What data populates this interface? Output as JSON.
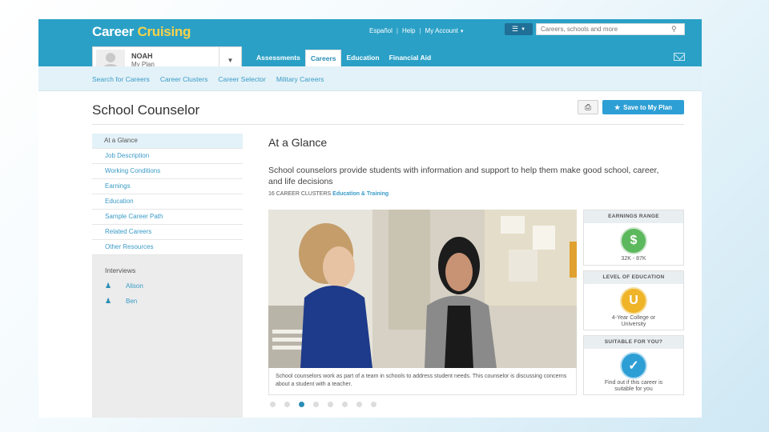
{
  "header": {
    "logo_part1": "Career ",
    "logo_part2": "Cruising",
    "links": [
      "Español",
      "Help",
      "My Account"
    ],
    "search_placeholder": "Careers, schools and more",
    "user": {
      "name": "NOAH",
      "plan": "My Plan"
    },
    "nav": [
      "Assessments",
      "Careers",
      "Education",
      "Financial Aid"
    ],
    "active_nav": "Careers"
  },
  "subnav": [
    "Search for Careers",
    "Career Clusters",
    "Career Selector",
    "Military Careers"
  ],
  "page": {
    "title": "School Counselor",
    "print_icon": "printer-icon",
    "save_label": "Save to My Plan"
  },
  "sidebar": {
    "items": [
      "At a Glance",
      "Job Description",
      "Working Conditions",
      "Earnings",
      "Education",
      "Sample Career Path",
      "Related Careers",
      "Other Resources"
    ],
    "active": "At a Glance",
    "interviews_label": "Interviews",
    "interviews": [
      "Alison",
      "Ben"
    ]
  },
  "content": {
    "heading": "At a Glance",
    "description": "School counselors provide students with information and support to help them make good school, career, and life decisions",
    "clusters_label": "16 CAREER CLUSTERS",
    "clusters_value": "Education & Training",
    "caption": "School counselors work as part of a team in schools to address student needs. This counselor is discussing concerns about a student with a teacher.",
    "slides_total": 8,
    "slide_active": 3
  },
  "cards": {
    "earnings": {
      "title": "EARNINGS RANGE",
      "symbol": "$",
      "value": "32K - 87K"
    },
    "education": {
      "title": "LEVEL OF EDUCATION",
      "symbol": "U",
      "value": "4-Year College or University"
    },
    "suitable": {
      "title": "SUITABLE FOR YOU?",
      "symbol": "✓",
      "value": "Find out if this career is suitable for you"
    }
  },
  "colors": {
    "brand": "#2aa0c6",
    "logo_accent": "#f7d24a",
    "link": "#3a9bc7",
    "earnings_badge": "#5cb85c",
    "education_badge": "#f0b429",
    "suitable_badge": "#2e9fd5"
  }
}
